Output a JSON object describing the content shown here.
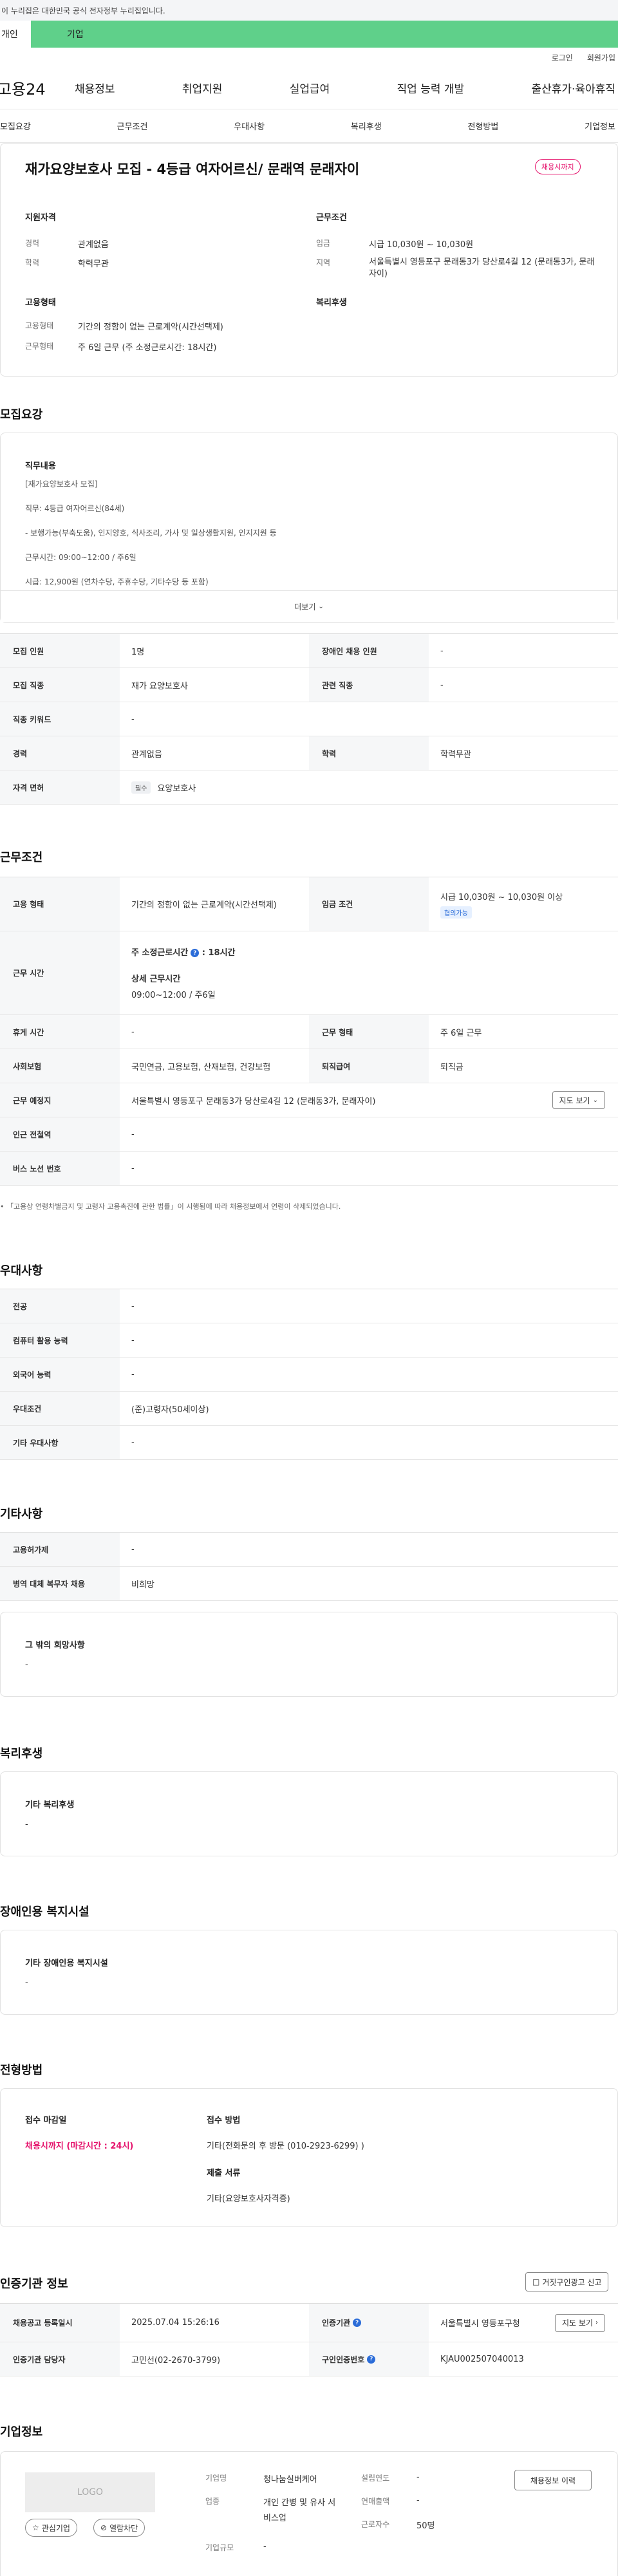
{
  "gov_bar": "이 누리집은 대한민국 공식 전자정부 누리집입니다.",
  "tabs": {
    "personal": "개인",
    "company": "기업"
  },
  "util": {
    "login": "로그인",
    "signup": "회원가입"
  },
  "logo": "고용24",
  "gnb": [
    "채용정보",
    "취업지원",
    "실업급여",
    "직업 능력 개발",
    "출산휴가·육아휴직"
  ],
  "subtabs": [
    "모집요강",
    "근무조건",
    "우대사항",
    "복리후생",
    "전형방법",
    "기업정보"
  ],
  "job": {
    "title": "재가요양보호사 모집 - 4등급 여자어르신/ 문래역 문래자이",
    "status_tag": "채용시까지",
    "qual_title": "지원자격",
    "career_label": "경력",
    "career_value": "관계없음",
    "edu_label": "학력",
    "edu_value": "학력무관",
    "cond_title": "근무조건",
    "wage_label": "임금",
    "wage_value": "시급 10,030원 ~ 10,030원",
    "region_label": "지역",
    "region_value": "서울특별시 영등포구 문래동3가 당산로4길 12 (문래동3가, 문래자이)",
    "emp_title": "고용형태",
    "emp_label": "고용형태",
    "emp_value": "기간의 정함이 없는 근로계약(시간선택제)",
    "work_label": "근무형태",
    "work_value": "주 6일 근무 (주 소정근로시간: 18시간)",
    "welfare_title": "복리후생"
  },
  "recruit": {
    "title": "모집요강",
    "duty_label": "직무내용",
    "duty_lines": [
      "[재가요양보호사 모집]",
      "직무: 4등급 여자어르신(84세)",
      "- 보행가능(부축도움), 인지양호, 식사조리, 가사 및 일상생활지원, 인지지원 등",
      "근무시간: 09:00~12:00 / 주6일",
      "시급: 12,900원 (연차수당, 주휴수당, 기타수당 등 포함)"
    ],
    "more": "더보기",
    "rows": {
      "count_label": "모집 인원",
      "count_value": "1명",
      "disabled_label": "장애인 채용 인원",
      "disabled_value": "-",
      "job_label": "모집 직종",
      "job_value": "재가 요양보호사",
      "related_label": "관련 직종",
      "related_value": "-",
      "keyword_label": "직종 키워드",
      "keyword_value": "-",
      "career_label": "경력",
      "career_value": "관계없음",
      "edu_label": "학력",
      "edu_value": "학력무관",
      "license_label": "자격 면허",
      "license_badge": "필수",
      "license_value": "요양보호사"
    }
  },
  "conditions": {
    "title": "근무조건",
    "emp_label": "고용 형태",
    "emp_value": "기간의 정함이 없는 근로계약(시간선택제)",
    "wage_label": "임금 조건",
    "wage_value": "시급 10,030원 ~ 10,030원 이상",
    "wage_badge": "협의가능",
    "hours_label": "근무 시간",
    "hours_weekly": "주 소정근로시간",
    "hours_weekly_value": ": 18시간",
    "hours_detail_label": "상세 근무시간",
    "hours_detail_value": "09:00~12:00 / 주6일",
    "rest_label": "휴게 시간",
    "rest_value": "-",
    "worktype_label": "근무 형태",
    "worktype_value": "주 6일 근무",
    "insurance_label": "사회보험",
    "insurance_value": "국민연금, 고용보험, 산재보험, 건강보험",
    "retire_label": "퇴직급여",
    "retire_value": "퇴직금",
    "place_label": "근무 예정지",
    "place_value": "서울특별시 영등포구 문래동3가 당산로4길 12 (문래동3가, 문래자이)",
    "map_btn": "지도 보기",
    "subway_label": "인근 전철역",
    "subway_value": "-",
    "bus_label": "버스 노선 번호",
    "bus_value": "-",
    "notice": "「고용상 연령차별금지 및 고령자 고용촉진에 관한 법률」이 시행됨에 따라 채용정보에서 연령이 삭제되었습니다."
  },
  "preference": {
    "title": "우대사항",
    "major_label": "전공",
    "major_value": "-",
    "computer_label": "컴퓨터 활용 능력",
    "computer_value": "-",
    "lang_label": "외국어 능력",
    "lang_value": "-",
    "pref_label": "우대조건",
    "pref_value": "(준)고령자(50세이상)",
    "etc_label": "기타 우대사항",
    "etc_value": "-"
  },
  "etc": {
    "title": "기타사항",
    "permit_label": "고용허가제",
    "permit_value": "-",
    "military_label": "병역 대체 복무자 채용",
    "military_value": "비희망",
    "hope_label": "그 밖의 희망사항",
    "hope_value": "-"
  },
  "welfare": {
    "title": "복리후생",
    "label": "기타 복리후생",
    "value": "-"
  },
  "disabled": {
    "title": "장애인용 복지시설",
    "label": "기타 장애인용 복지시설",
    "value": "-"
  },
  "selection": {
    "title": "전형방법",
    "deadline_label": "접수 마감일",
    "deadline_value": "채용시까지 (마감시간 : 24시)",
    "method_label": "접수 방법",
    "method_value": "기타(전화문의 후 방문 (010-2923-6299) )",
    "docs_label": "제출 서류",
    "docs_value": "기타(요양보호사자격증)"
  },
  "agency": {
    "title": "인증기관 정보",
    "report_btn": "거짓구인광고 신고",
    "reg_label": "채용공고 등록일시",
    "reg_value": "2025.07.04 15:26:16",
    "org_label": "인증기관",
    "org_value": "서울특별시 영등포구청",
    "map_btn": "지도 보기",
    "manager_label": "인증기관 담당자",
    "manager_value": "고민선(02-2670-3799)",
    "id_label": "구인인증번호",
    "id_value": "KJAU002507040013"
  },
  "company": {
    "title": "기업정보",
    "logo": "LOGO",
    "fav_btn": "관심기업",
    "block_btn": "열람차단",
    "name_label": "기업명",
    "name_value": "청나눔실버케어",
    "biz_label": "업종",
    "biz_value": "개인 간병 및 유사 서비스업",
    "size_label": "기업규모",
    "size_value": "-",
    "founded_label": "설립연도",
    "founded_value": "-",
    "revenue_label": "연매출액",
    "revenue_value": "-",
    "staff_label": "근로자수",
    "staff_value": "50명",
    "history_btn": "채용정보 이력"
  }
}
